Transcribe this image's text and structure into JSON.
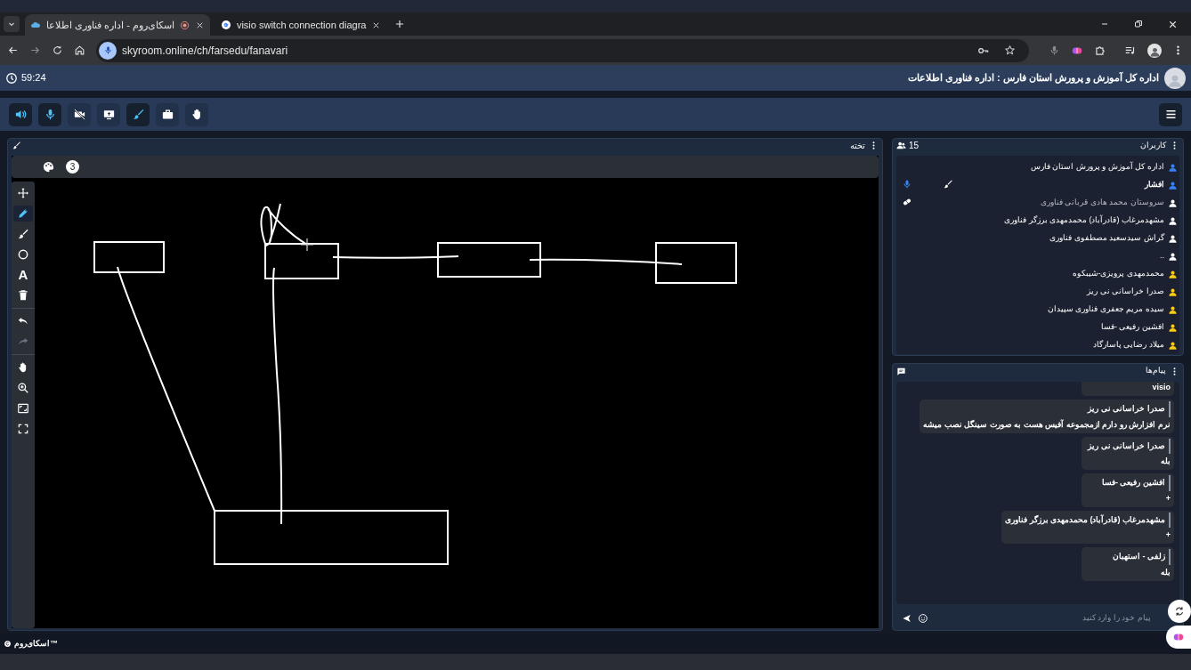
{
  "browser": {
    "left_tab": {
      "title": "اسکای‌روم - اداره فناوری اطلاعا",
      "selected": true,
      "recording": true
    },
    "right_tab": {
      "title": "visio switch connection diagra",
      "selected": false,
      "recording": false
    },
    "url": "skyroom.online/ch/farsedu/fanavari"
  },
  "header": {
    "timer": "59:24",
    "title": "اداره کل آموزش و پرورش استان فارس : اداره فناوری اطلاعات"
  },
  "toolbar": [
    {
      "kind": "speaker",
      "active": true
    },
    {
      "kind": "mic",
      "active": true
    },
    {
      "kind": "camera-off",
      "active": false
    },
    {
      "kind": "screen",
      "active": false
    },
    {
      "kind": "brush",
      "active": true
    },
    {
      "kind": "briefcase",
      "active": false
    },
    {
      "kind": "hand",
      "active": false
    }
  ],
  "whiteboard": {
    "title": "تخته",
    "page": "3",
    "tools": [
      {
        "kind": "move",
        "selected": false,
        "disabled": false
      },
      {
        "kind": "pencil",
        "selected": true,
        "disabled": false
      },
      {
        "kind": "brush",
        "selected": false,
        "disabled": false
      },
      {
        "kind": "circle",
        "selected": false,
        "disabled": false
      },
      {
        "kind": "text",
        "glyph": "A",
        "selected": false,
        "disabled": false
      },
      {
        "kind": "trash",
        "selected": false,
        "disabled": false
      },
      {
        "kind": "undo",
        "selected": false,
        "disabled": false
      },
      {
        "kind": "redo",
        "selected": false,
        "disabled": true
      },
      {
        "kind": "hand",
        "selected": false,
        "disabled": false
      },
      {
        "kind": "zoom",
        "selected": false,
        "disabled": false
      },
      {
        "kind": "image",
        "selected": false,
        "disabled": false
      },
      {
        "kind": "fullscreen",
        "selected": false,
        "disabled": false
      }
    ]
  },
  "users": {
    "title": "کاربران",
    "count": "15",
    "list": [
      {
        "name": "اداره کل آموزش و پرورش استان فارس",
        "color": "#3b82f6",
        "bold": false,
        "dimmed": false,
        "mic": false,
        "brush": false,
        "eraser": false
      },
      {
        "name": "افشار",
        "color": "#3b82f6",
        "bold": true,
        "dimmed": false,
        "mic": true,
        "brush": true,
        "eraser": false
      },
      {
        "name": "سروستان محمد هادی قربانی فناوری",
        "color": "#ffffff",
        "bold": false,
        "dimmed": true,
        "mic": false,
        "brush": false,
        "eraser": true
      },
      {
        "name": "مشهدمرغاب (قادرآباد) محمدمهدی برزگر فناوری",
        "color": "#ffffff",
        "bold": false,
        "dimmed": false,
        "mic": false,
        "brush": false,
        "eraser": false
      },
      {
        "name": "گراش سیدسعید مصطفوی فناوری",
        "color": "#ffffff",
        "bold": false,
        "dimmed": false,
        "mic": false,
        "brush": false,
        "eraser": false
      },
      {
        "name": "..",
        "color": "#ffffff",
        "bold": false,
        "dimmed": false,
        "mic": false,
        "brush": false,
        "eraser": false
      },
      {
        "name": "محمدمهدی پرویزی-شیبکوه",
        "color": "#facc15",
        "bold": false,
        "dimmed": false,
        "mic": false,
        "brush": false,
        "eraser": false
      },
      {
        "name": "صدرا خراسانی نی ریز",
        "color": "#facc15",
        "bold": false,
        "dimmed": false,
        "mic": false,
        "brush": false,
        "eraser": false
      },
      {
        "name": "سیده مریم جعفری فناوری سپیدان",
        "color": "#facc15",
        "bold": false,
        "dimmed": false,
        "mic": false,
        "brush": false,
        "eraser": false
      },
      {
        "name": "افشین رفیعی -فسا",
        "color": "#facc15",
        "bold": false,
        "dimmed": false,
        "mic": false,
        "brush": false,
        "eraser": false
      },
      {
        "name": "میلاد رضایی پاسارگاد",
        "color": "#facc15",
        "bold": false,
        "dimmed": false,
        "mic": false,
        "brush": false,
        "eraser": false
      }
    ]
  },
  "messages": {
    "title": "پیام‌ها",
    "placeholder": "پیام خود را وارد کنید",
    "list": [
      {
        "text": "visio"
      },
      {
        "sender": "صدرا خراسانی نی ریز",
        "text": "نرم افزارش رو دارم ازمجموعه آفیس هست به صورت سینگل نصب میشه"
      },
      {
        "sender": "صدرا خراسانی نی ریز",
        "text": "بله"
      },
      {
        "sender": "افشین رفیعی -فسا",
        "text": "+"
      },
      {
        "sender": "مشهدمرغاب (قادرآباد) محمدمهدی برزگر فناوری",
        "text": "+"
      },
      {
        "sender": "زلفی - استهبان",
        "text": "بله"
      }
    ]
  },
  "footer": {
    "brand": "اسکای‌روم™"
  }
}
